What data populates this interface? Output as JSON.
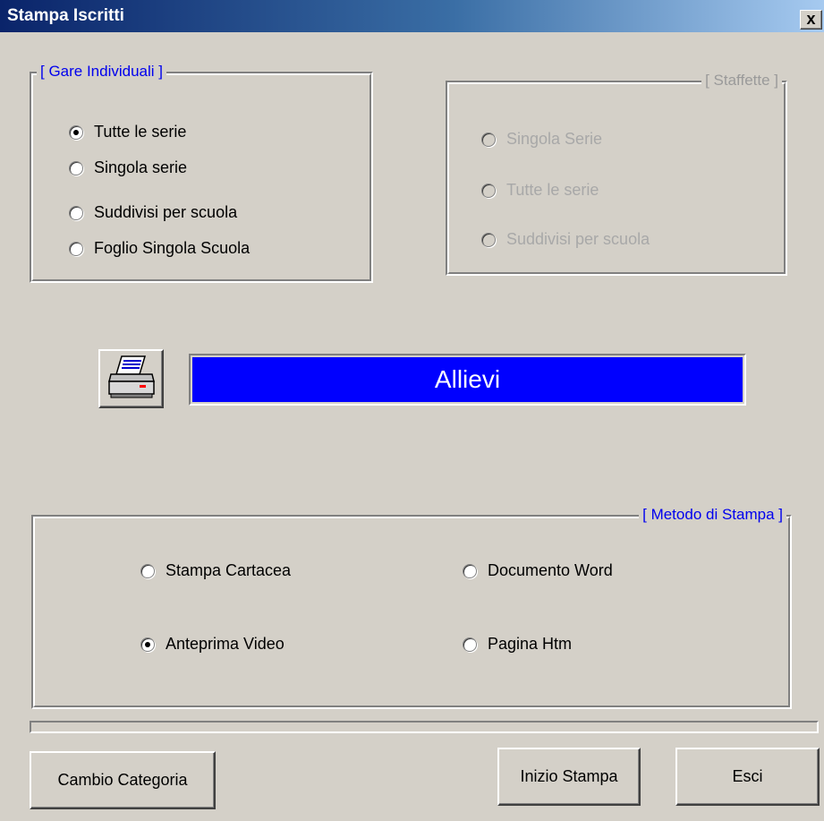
{
  "window": {
    "title": "Stampa Iscritti",
    "close_label": "x"
  },
  "gare_individuali": {
    "legend": "[ Gare Individuali ]",
    "options": [
      {
        "label": "Tutte le serie",
        "checked": true
      },
      {
        "label": "Singola serie",
        "checked": false
      },
      {
        "label": "Suddivisi per scuola",
        "checked": false
      },
      {
        "label": "Foglio Singola Scuola",
        "checked": false
      }
    ]
  },
  "staffette": {
    "legend": "[ Staffette ]",
    "enabled": false,
    "options": [
      {
        "label": "Singola Serie",
        "checked": false
      },
      {
        "label": "Tutte le serie",
        "checked": false
      },
      {
        "label": "Suddivisi per scuola",
        "checked": false
      }
    ]
  },
  "category": {
    "label": "Allievi",
    "icon": "printer-icon"
  },
  "metodo_stampa": {
    "legend": "[ Metodo di Stampa ]",
    "options": [
      {
        "label": "Stampa Cartacea",
        "checked": false
      },
      {
        "label": "Documento Word",
        "checked": false
      },
      {
        "label": "Anteprima Video",
        "checked": true
      },
      {
        "label": "Pagina Htm",
        "checked": false
      }
    ]
  },
  "buttons": {
    "cambio_categoria": "Cambio Categoria",
    "inizio_stampa": "Inizio Stampa",
    "esci": "Esci"
  },
  "colors": {
    "face": "#d4d0c8",
    "legend_text": "#0000ee",
    "category_bg": "#0000ff",
    "category_text": "#ffffff",
    "title_gradient_start": "#0a246a",
    "title_gradient_end": "#a6caf0"
  }
}
